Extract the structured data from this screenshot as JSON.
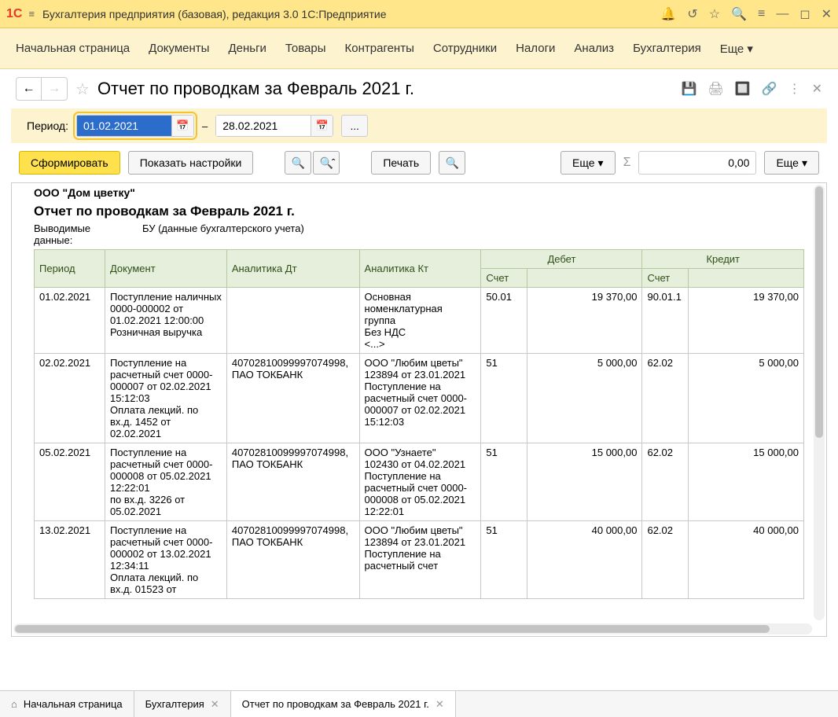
{
  "app_title": "Бухгалтерия предприятия (базовая), редакция 3.0 1С:Предприятие",
  "main_menu": [
    "Начальная страница",
    "Документы",
    "Деньги",
    "Товары",
    "Контрагенты",
    "Сотрудники",
    "Налоги",
    "Анализ",
    "Бухгалтерия",
    "Еще ▾"
  ],
  "report_title": "Отчет по проводкам за Февраль 2021 г.",
  "period": {
    "label": "Период:",
    "from": "01.02.2021",
    "to": "28.02.2021",
    "dash": "–"
  },
  "toolbar": {
    "generate": "Сформировать",
    "settings": "Показать настройки",
    "print": "Печать",
    "more1": "Еще",
    "more2": "Еще",
    "sum": "Σ",
    "num_value": "0,00"
  },
  "report": {
    "org": "ООО \"Дом цветку\"",
    "name": "Отчет по проводкам за Февраль 2021 г.",
    "sub_label": "Выводимые данные:",
    "sub_value": "БУ (данные бухгалтерского учета)",
    "headers": {
      "period": "Период",
      "document": "Документ",
      "analytics_dt": "Аналитика Дт",
      "analytics_kt": "Аналитика Кт",
      "debit": "Дебет",
      "credit": "Кредит",
      "account": "Счет"
    },
    "rows": [
      {
        "period": "01.02.2021",
        "document": "Поступление наличных 0000-000002 от 01.02.2021 12:00:00\nРозничная выручка",
        "an_dt": "",
        "an_kt": "Основная номенклатурная группа\nБез НДС\n<...>",
        "d_acc": "50.01",
        "d_val": "19 370,00",
        "c_acc": "90.01.1",
        "c_val": "19 370,00"
      },
      {
        "period": "02.02.2021",
        "document": "Поступление на расчетный счет 0000-000007 от 02.02.2021 15:12:03\nОплата лекций. по вх.д. 1452 от 02.02.2021",
        "an_dt": "40702810099997074998, ПАО ТОКБАНК",
        "an_kt": "ООО \"Любим цветы\"\n123894 от 23.01.2021\nПоступление на расчетный счет 0000-000007 от 02.02.2021 15:12:03",
        "d_acc": "51",
        "d_val": "5 000,00",
        "c_acc": "62.02",
        "c_val": "5 000,00"
      },
      {
        "period": "05.02.2021",
        "document": "Поступление на расчетный счет 0000-000008 от 05.02.2021 12:22:01\n по вх.д. 3226 от 05.02.2021",
        "an_dt": "40702810099997074998, ПАО ТОКБАНК",
        "an_kt": "ООО \"Узнаете\"\n102430 от 04.02.2021\nПоступление на расчетный счет 0000-000008 от 05.02.2021 12:22:01",
        "d_acc": "51",
        "d_val": "15 000,00",
        "c_acc": "62.02",
        "c_val": "15 000,00"
      },
      {
        "period": "13.02.2021",
        "document": "Поступление на расчетный счет 0000-000002 от 13.02.2021 12:34:11\nОплата лекций. по вх.д. 01523 от",
        "an_dt": "40702810099997074998, ПАО ТОКБАНК",
        "an_kt": "ООО \"Любим цветы\"\n123894 от 23.01.2021\nПоступление на расчетный счет",
        "d_acc": "51",
        "d_val": "40 000,00",
        "c_acc": "62.02",
        "c_val": "40 000,00"
      }
    ]
  },
  "bottom_tabs": {
    "home": "Начальная страница",
    "t2": "Бухгалтерия",
    "t3": "Отчет по проводкам за Февраль 2021 г."
  }
}
